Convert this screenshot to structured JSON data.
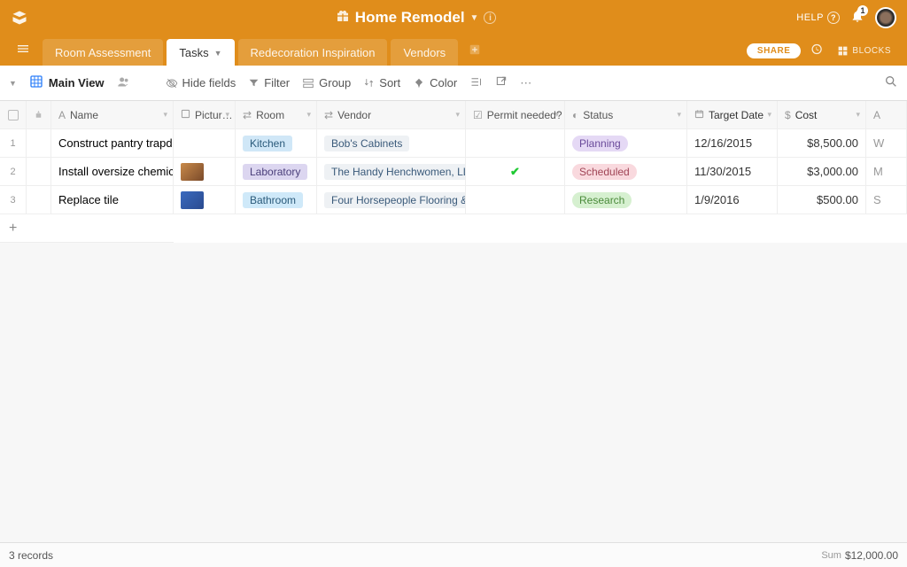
{
  "topbar": {
    "title": "Home Remodel",
    "help": "HELP",
    "notification_count": "1"
  },
  "tabs": {
    "items": [
      "Room Assessment",
      "Tasks",
      "Redecoration Inspiration",
      "Vendors"
    ],
    "active_index": 1,
    "share": "SHARE",
    "blocks": "BLOCKS"
  },
  "toolbar": {
    "view_name": "Main View",
    "hide_fields": "Hide fields",
    "filter": "Filter",
    "group": "Group",
    "sort": "Sort",
    "color": "Color"
  },
  "columns": {
    "name": "Name",
    "picture": "Pictur…",
    "room": "Room",
    "vendor": "Vendor",
    "permit": "Permit needed?",
    "status": "Status",
    "target_date": "Target Date",
    "cost": "Cost"
  },
  "rows": [
    {
      "num": "1",
      "name": "Construct pantry trapdoor",
      "room": "Kitchen",
      "room_class": "room-kitchen",
      "vendor": "Bob's Cabinets",
      "permit": false,
      "status": "Planning",
      "status_class": "status-planning",
      "date": "12/16/2015",
      "cost": "$8,500.00",
      "thumb_class": ""
    },
    {
      "num": "2",
      "name": "Install oversize chemical …",
      "room": "Laboratory",
      "room_class": "room-lab",
      "vendor": "The Handy Henchwomen, LLC",
      "permit": true,
      "status": "Scheduled",
      "status_class": "status-scheduled",
      "date": "11/30/2015",
      "cost": "$3,000.00",
      "thumb_class": "t1"
    },
    {
      "num": "3",
      "name": "Replace tile",
      "room": "Bathroom",
      "room_class": "room-bath",
      "vendor": "Four Horsepeople Flooring & Tile",
      "permit": false,
      "status": "Research",
      "status_class": "status-research",
      "date": "1/9/2016",
      "cost": "$500.00",
      "thumb_class": "t2"
    }
  ],
  "footer": {
    "record_count": "3 records",
    "sum_label": "Sum",
    "sum_value": "$12,000.00"
  }
}
